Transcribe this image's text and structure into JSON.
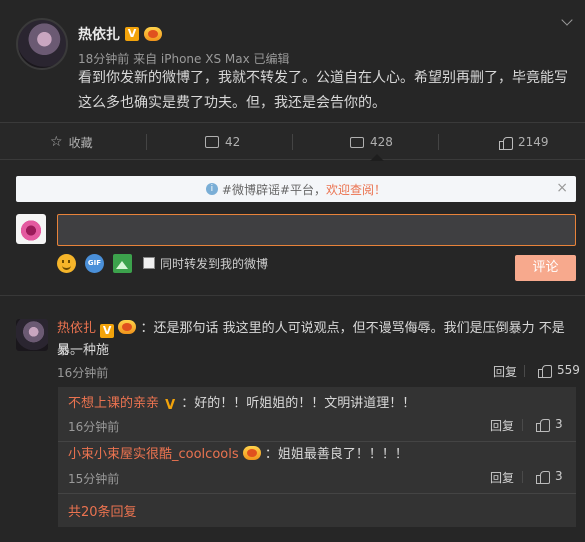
{
  "post": {
    "username": "热依扎",
    "v_badge": "V",
    "meta": "18分钟前 来自 iPhone XS Max  已编辑",
    "content_line1": "看到你发新的微博了，我就不转发了。公道自在人心。希望别再删了，毕竟能写",
    "content_line2": "这么多也确实是费了功夫。但，我还是会告你的。"
  },
  "actions": {
    "favorite": "收藏",
    "repost_count": "42",
    "comment_count": "428",
    "like_count": "2149"
  },
  "notice": {
    "text": "#微博辟谣#平台，",
    "highlight": "欢迎查阅！"
  },
  "composer": {
    "input_value": "",
    "gif_label": "GIF",
    "repost_checkbox_label": "同时转发到我的微博",
    "submit_label": "评论"
  },
  "comments": [
    {
      "name": "热依扎",
      "v_badge": "V",
      "text_line1": "：还是那句话 我这里的人可说观点，但不谩骂侮辱。我们是压倒暴力 不是另一种施",
      "text_line2": "暴。",
      "time": "16分钟前",
      "reply_label": "回复",
      "like_count": "559",
      "replies": [
        {
          "name": "不想上课的亲亲",
          "v_badge": "V",
          "text": "：好的！！听姐姐的！！文明讲道理！！",
          "time": "16分钟前",
          "reply_label": "回复",
          "like_count": "3"
        },
        {
          "name": "小束小束屋实很酷_coolcools",
          "text": "：姐姐最善良了！！！！",
          "time": "15分钟前",
          "reply_label": "回复",
          "like_count": "3"
        }
      ],
      "more_replies": "共20条回复"
    }
  ],
  "colors": {
    "background": "#262626",
    "accent": "#eb7350",
    "input_border": "#e8833a",
    "submit_bg": "#f7a98d",
    "v_badge": "#f2a30b"
  }
}
